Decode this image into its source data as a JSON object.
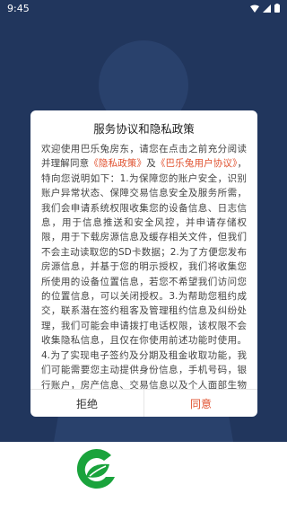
{
  "status_bar": {
    "time": "9:45",
    "icons": [
      "wifi-icon",
      "signal-icon",
      "battery-icon"
    ]
  },
  "dialog": {
    "title": "服务协议和隐私政策",
    "body_intro": "欢迎使用巴乐兔房东，请您在点击之前充分阅读并理解同意",
    "privacy_link": "《隐私政策》",
    "and_text": "及",
    "user_agreement_link": "《巴乐兔用户协议》",
    "body_rest": "，特向您说明如下：1.为保障您的账户安全，识别账户异常状态、保障交易信息安全及服务所需，我们会申请系统权限收集您的设备信息、日志信息，用于信息推送和安全风控，并申请存储权限，用于下载房源信息及缓存相关文件，但我们不会主动读取您的SD卡数据；2.为了方便您发布房源信息，并基于您的明示授权，我们将收集您所使用的设备位置信息，若您不希望我们访问您的位置信息，可以关闭授权。3.为帮助您租约成交，联系潜在签约租客及管理租约信息及纠纷处理，我们可能会申请拨打电话权限，该权限不会收集隐私信息，且仅在你使用前述功能时使用。4.为了实现电子签约及分期及租金收取功能，我们可能需要您主动提供身份信息，手机号码，银行账户，房产信息、交易信息以及个人面部生物特征信等个人敏感信息，若您拒绝提供，可能无法实现该功能，但不影响",
    "reject_label": "拒绝",
    "agree_label": "同意"
  },
  "colors": {
    "background_blue": "#2f4c82",
    "accent_red": "#e0512f",
    "logo_green": "#1aa33c"
  },
  "logo": "leaf-logo-icon"
}
